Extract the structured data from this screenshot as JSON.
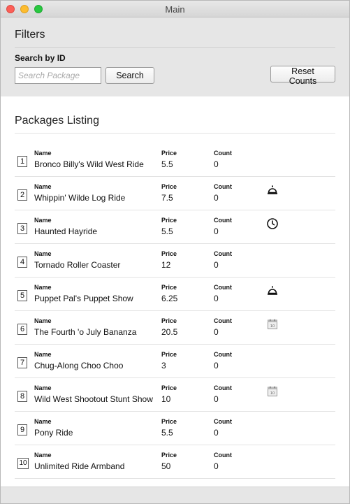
{
  "window": {
    "title": "Main"
  },
  "filters": {
    "heading": "Filters",
    "search_label": "Search by ID",
    "search_placeholder": "Search Package",
    "search_value": "",
    "search_button": "Search",
    "reset_button": "Reset Counts"
  },
  "listing": {
    "heading": "Packages Listing",
    "col_name": "Name",
    "col_price": "Price",
    "col_count": "Count",
    "packages": [
      {
        "id": "1",
        "name": "Bronco Billy's Wild West Ride",
        "price": "5.5",
        "count": "0",
        "icon": ""
      },
      {
        "id": "2",
        "name": "Whippin' Wilde Log Ride",
        "price": "7.5",
        "count": "0",
        "icon": "service-bell-icon"
      },
      {
        "id": "3",
        "name": "Haunted Hayride",
        "price": "5.5",
        "count": "0",
        "icon": "clock-icon"
      },
      {
        "id": "4",
        "name": "Tornado Roller Coaster",
        "price": "12",
        "count": "0",
        "icon": ""
      },
      {
        "id": "5",
        "name": "Puppet Pal's Puppet Show",
        "price": "6.25",
        "count": "0",
        "icon": "service-bell-icon"
      },
      {
        "id": "6",
        "name": "The Fourth 'o July Bananza",
        "price": "20.5",
        "count": "0",
        "icon": "calendar-icon"
      },
      {
        "id": "7",
        "name": "Chug-Along Choo Choo",
        "price": "3",
        "count": "0",
        "icon": ""
      },
      {
        "id": "8",
        "name": "Wild West Shootout Stunt Show",
        "price": "10",
        "count": "0",
        "icon": "calendar-icon"
      },
      {
        "id": "9",
        "name": "Pony Ride",
        "price": "5.5",
        "count": "0",
        "icon": ""
      },
      {
        "id": "10",
        "name": "Unlimited Ride Armband",
        "price": "50",
        "count": "0",
        "icon": ""
      }
    ]
  }
}
